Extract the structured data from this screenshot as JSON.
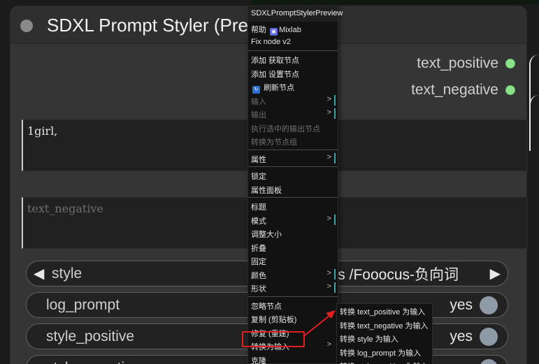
{
  "node": {
    "title": "SDXL Prompt Styler (Preview)",
    "outputs": [
      "text_positive",
      "text_negative"
    ],
    "text_positive_value": "1girl,",
    "text_negative_placeholder": "text_negative",
    "style": {
      "label": "style",
      "value": "s /Fooocus-负向词"
    },
    "toggles": [
      {
        "label": "log_prompt",
        "value": "yes"
      },
      {
        "label": "style_positive",
        "value": "yes"
      },
      {
        "label": "style_negative",
        "value": "yes"
      }
    ]
  },
  "context_menu": {
    "header": "SDXLPromptStylerPreview",
    "help_label": "帮助",
    "help_plugin": "Mixlab",
    "fix_node": "Fix node v2",
    "add_get_node": "添加 获取节点",
    "add_set_node": "添加 设置节点",
    "refresh_node": "刷新节点",
    "inputs": "输入",
    "outputs": "输出",
    "execute_selected": "执行选中的输出节点",
    "convert_group": "转换为节点组",
    "properties": "属性",
    "lock": "锁定",
    "properties_panel": "属性面板",
    "title": "标题",
    "mode": "模式",
    "resize": "调整大小",
    "collapse": "折叠",
    "pin": "固定",
    "color": "颜色",
    "shape": "形状",
    "bypass": "忽略节点",
    "copy": "复制 (剪贴板)",
    "repair": "修复 (重建)",
    "convert_to_input": "转换为输入",
    "clone": "克隆"
  },
  "submenu": {
    "items": [
      "转换 text_positive 为输入",
      "转换 text_negative 为输入",
      "转换 style 为输入",
      "转换 log_prompt 为输入",
      "转换 style_positive 为输入"
    ]
  },
  "colors": {
    "highlight": "#e02020",
    "output_slot": "#8be28b",
    "submenu_marker": "#3ba3b3"
  }
}
